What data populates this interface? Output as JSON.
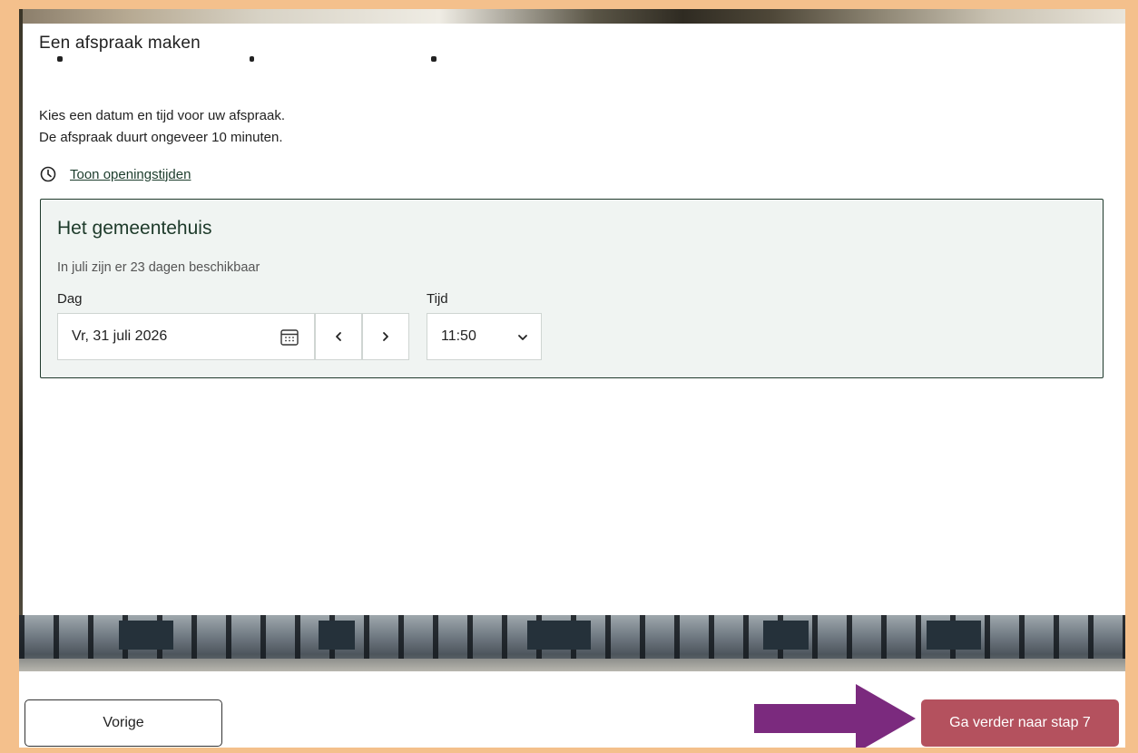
{
  "modal": {
    "title": "Een afspraak maken"
  },
  "intro": {
    "line1": "Kies een datum en tijd voor uw afspraak.",
    "line2": "De afspraak duurt ongeveer 10 minuten."
  },
  "opening_hours": {
    "label": "Toon openingstijden",
    "icon": "clock-icon"
  },
  "location": {
    "name": "Het gemeentehuis",
    "availability": "In juli zijn er 23 dagen beschikbaar",
    "day_label": "Dag",
    "time_label": "Tijd",
    "selected_date": "Vr, 31 juli 2026",
    "calendar_icon": "calendar-icon",
    "prev_day_icon": "chevron-left-icon",
    "next_day_icon": "chevron-right-icon",
    "selected_time": "11:50",
    "time_dropdown_icon": "chevron-down-icon"
  },
  "footer": {
    "prev_label": "Vorige",
    "next_label": "Ga verder naar stap 7"
  },
  "colors": {
    "page_border": "#f4c08c",
    "accent_dark_green": "#1d3a2a",
    "location_box_bg": "#f0f4f2",
    "primary_button": "#b4515e",
    "arrow": "#7b2a7e"
  }
}
